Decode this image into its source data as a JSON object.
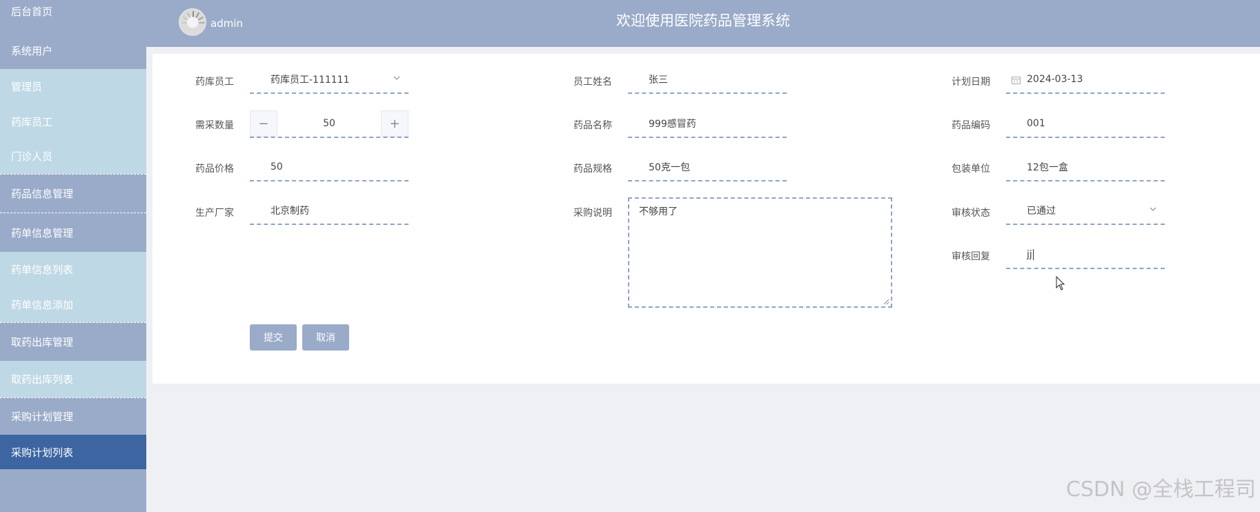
{
  "sidebar": {
    "items": [
      {
        "label": "后台首页"
      },
      {
        "label": "系统用户"
      },
      {
        "label": "管理员"
      },
      {
        "label": "药库员工"
      },
      {
        "label": "门诊人员"
      },
      {
        "label": "药品信息管理"
      },
      {
        "label": "药单信息管理"
      },
      {
        "label": "药单信息列表"
      },
      {
        "label": "药单信息添加"
      },
      {
        "label": "取药出库管理"
      },
      {
        "label": "取药出库列表"
      },
      {
        "label": "采购计划管理"
      },
      {
        "label": "采购计划列表"
      }
    ]
  },
  "header": {
    "user": "admin",
    "title": "欢迎使用医院药品管理系统"
  },
  "form": {
    "staff": {
      "label": "药库员工",
      "value": "药库员工-111111"
    },
    "staff_name": {
      "label": "员工姓名",
      "value": "张三"
    },
    "plan_date": {
      "label": "计划日期",
      "value": "2024-03-13"
    },
    "quantity": {
      "label": "需采数量",
      "value": "50",
      "minus": "−",
      "plus": "+"
    },
    "drug_name": {
      "label": "药品名称",
      "value": "999感冒药"
    },
    "drug_code": {
      "label": "药品编码",
      "value": "001"
    },
    "drug_price": {
      "label": "药品价格",
      "value": "50"
    },
    "drug_spec": {
      "label": "药品规格",
      "value": "50克一包"
    },
    "pack_unit": {
      "label": "包装单位",
      "value": "12包一盒"
    },
    "manufacturer": {
      "label": "生产厂家",
      "value": "北京制药"
    },
    "purchase_note": {
      "label": "采购说明",
      "value": "不够用了"
    },
    "review_status": {
      "label": "审核状态",
      "value": "已通过"
    },
    "review_reply": {
      "label": "审核回复",
      "value": "jj"
    },
    "submit_label": "提交",
    "cancel_label": "取消"
  },
  "watermark": "CSDN @全栈工程司",
  "colors": {
    "sidebar_bg": "#9aabc9",
    "sidebar_sub_bg": "#bfd8e5",
    "sidebar_active": "#3c65a1",
    "header_bg": "#9aabc9",
    "page_bg": "#eff0f4",
    "field_border": "#8fa3c4"
  }
}
